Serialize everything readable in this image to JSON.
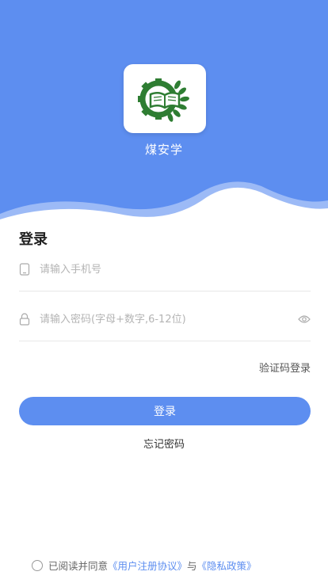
{
  "app": {
    "name": "煤安学"
  },
  "login": {
    "title": "登录",
    "phone_placeholder": "请输入手机号",
    "password_placeholder": "请输入密码(字母+数字,6-12位)",
    "code_login": "验证码登录",
    "submit": "登录",
    "forgot": "忘记密码"
  },
  "agreement": {
    "prefix": "已阅读并同意",
    "user_agreement": "《用户注册协议》",
    "conj": "与",
    "privacy": "《隐私政策》"
  },
  "colors": {
    "primary": "#5d8ef0",
    "logo_green": "#2e7d32"
  },
  "icons": {
    "phone": "phone-icon",
    "lock": "lock-icon",
    "eye": "eye-icon",
    "logo": "book-gear-logo-icon"
  }
}
